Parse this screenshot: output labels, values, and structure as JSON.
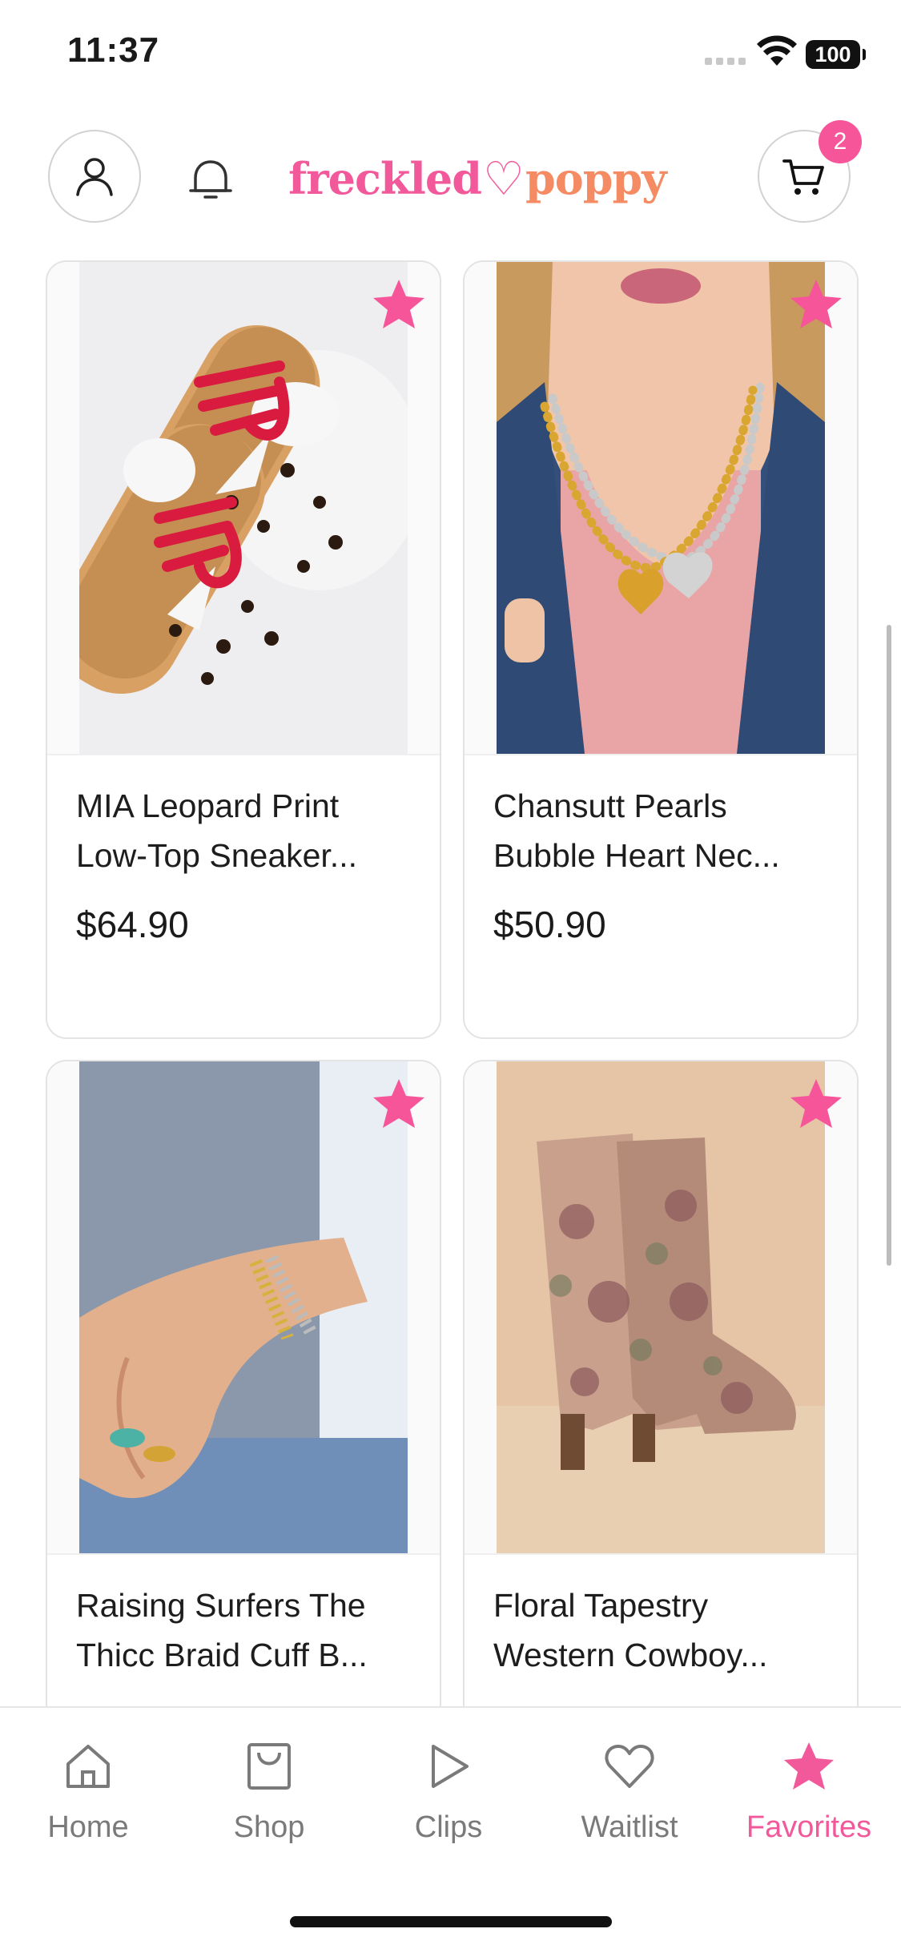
{
  "status_bar": {
    "time": "11:37",
    "battery": "100"
  },
  "header": {
    "logo_part1": "freckled",
    "logo_heart": "♡",
    "logo_part2": "poppy",
    "cart_count": "2"
  },
  "products": [
    {
      "name": "MIA Leopard Print\nLow-Top Sneaker...",
      "price": "$64.90"
    },
    {
      "name": "Chansutt Pearls\nBubble Heart Nec...",
      "price": "$50.90"
    },
    {
      "name": "Raising Surfers The\nThicc Braid Cuff B...",
      "price": ""
    },
    {
      "name": "Floral Tapestry\nWestern Cowboy...",
      "price": ""
    }
  ],
  "tabs": [
    {
      "label": "Home",
      "icon": "home-icon"
    },
    {
      "label": "Shop",
      "icon": "bag-icon"
    },
    {
      "label": "Clips",
      "icon": "play-icon"
    },
    {
      "label": "Waitlist",
      "icon": "heart-icon"
    },
    {
      "label": "Favorites",
      "icon": "star-icon",
      "active": true
    }
  ],
  "colors": {
    "accent": "#f2599b",
    "tab_inactive": "#7a7a7a",
    "border": "#e3e3e3"
  }
}
